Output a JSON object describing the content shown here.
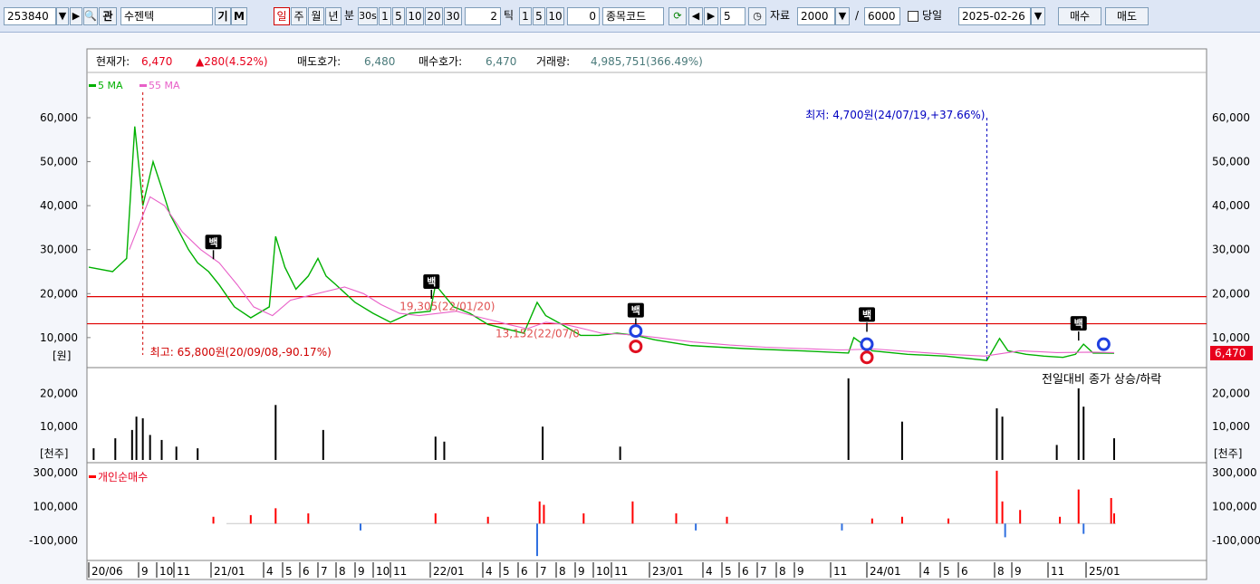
{
  "toolbar": {
    "code": "253840",
    "name": "수젠텍",
    "gi": "기",
    "m": "M",
    "periods": [
      "일",
      "주",
      "월",
      "년"
    ],
    "minute_label": "분",
    "minute_values": [
      "30s",
      "1",
      "5",
      "10",
      "20",
      "30"
    ],
    "minute_input": "2",
    "tick_label": "틱",
    "tick_values": [
      "1",
      "5",
      "10"
    ],
    "tick_input": "0",
    "code_label": "종목코드",
    "step_value": "5",
    "data_label": "자료",
    "data_count": "2000",
    "total_label": "/",
    "total_count": "6000",
    "today_label": "당일",
    "date": "2025-02-26",
    "buy_label": "매수",
    "sell_label": "매도"
  },
  "info": {
    "price_label": "현재가:",
    "price": "6,470",
    "change": "▲280(4.52%)",
    "ask_label": "매도호가:",
    "ask": "6,480",
    "bid_label": "매수호가:",
    "bid": "6,470",
    "volume_label": "거래량:",
    "volume": "4,985,751(366.49%)"
  },
  "colors": {
    "up": "#e8001c",
    "down": "#0033cc",
    "ma5": "#00b000",
    "ma55": "#e860c8",
    "candle_up": "#ff0000",
    "candle_down": "#0000ff",
    "volume": "#000000",
    "net_up": "#ff0000",
    "net_down": "#3070e0",
    "annot_high": "#d00000",
    "annot_low": "#0000c0",
    "hline": "#e00000",
    "last_badge": "#e8001c"
  },
  "chart_data": [
    {
      "type": "line",
      "panel": "price",
      "unit_label": "[원]",
      "y_range": [
        4000,
        67000
      ],
      "y_ticks": [
        10000,
        20000,
        30000,
        40000,
        50000,
        60000
      ],
      "y_tick_labels": [
        "10,000",
        "20,000",
        "30,000",
        "40,000",
        "50,000",
        "60,000"
      ],
      "legend": [
        "5 MA",
        "55 MA"
      ],
      "series": [
        {
          "name": "5 MA",
          "x": [
            "2020-06-01",
            "2020-07-15",
            "2020-08-10",
            "2020-08-25",
            "2020-09-08",
            "2020-09-25",
            "2020-10-10",
            "2020-10-25",
            "2020-11-10",
            "2020-11-25",
            "2020-12-10",
            "2020-12-28",
            "2021-01-15",
            "2021-02-10",
            "2021-03-10",
            "2021-04-10",
            "2021-04-20",
            "2021-05-05",
            "2021-05-25",
            "2021-06-15",
            "2021-07-01",
            "2021-07-15",
            "2021-08-01",
            "2021-09-01",
            "2021-10-01",
            "2021-11-01",
            "2021-12-01",
            "2022-01-01",
            "2022-01-10",
            "2022-02-10",
            "2022-03-10",
            "2022-04-10",
            "2022-05-10",
            "2022-06-10",
            "2022-07-01",
            "2022-07-15",
            "2022-08-10",
            "2022-09-10",
            "2022-10-10",
            "2022-11-10",
            "2022-12-10",
            "2023-01-10",
            "2023-03-10",
            "2023-06-10",
            "2023-09-10",
            "2023-12-01",
            "2023-12-10",
            "2024-01-10",
            "2024-03-10",
            "2024-05-10",
            "2024-07-19",
            "2024-08-10",
            "2024-08-25",
            "2024-09-25",
            "2024-10-25",
            "2024-11-25",
            "2024-12-15",
            "2024-12-28",
            "2025-01-15",
            "2025-02-26"
          ],
          "values": [
            26000,
            25000,
            28000,
            58000,
            40000,
            50000,
            44000,
            38000,
            34000,
            30000,
            27000,
            25000,
            22000,
            17000,
            14500,
            17000,
            33000,
            26000,
            21000,
            24000,
            28000,
            24000,
            22000,
            18000,
            15500,
            13500,
            15500,
            16000,
            22000,
            17000,
            15500,
            13000,
            12000,
            11000,
            18000,
            15000,
            13000,
            10500,
            10500,
            11000,
            10500,
            9500,
            8200,
            7500,
            7000,
            6500,
            10000,
            7000,
            6200,
            5800,
            4800,
            9800,
            7000,
            6200,
            5800,
            5500,
            6200,
            8500,
            6500,
            6470
          ]
        },
        {
          "name": "55 MA",
          "x": [
            "2020-08-15",
            "2020-09-20",
            "2020-10-15",
            "2020-11-15",
            "2020-12-15",
            "2021-01-15",
            "2021-02-15",
            "2021-03-15",
            "2021-04-15",
            "2021-05-15",
            "2021-06-15",
            "2021-07-15",
            "2021-08-15",
            "2021-09-15",
            "2021-10-15",
            "2021-11-15",
            "2021-12-15",
            "2022-01-15",
            "2022-02-15",
            "2022-03-15",
            "2022-04-15",
            "2022-05-15",
            "2022-06-15",
            "2022-07-15",
            "2022-08-15",
            "2022-09-15",
            "2022-10-15",
            "2022-11-15",
            "2022-12-15",
            "2023-01-15",
            "2023-03-15",
            "2023-05-15",
            "2023-07-15",
            "2023-09-15",
            "2023-11-15",
            "2024-01-15",
            "2024-03-15",
            "2024-05-15",
            "2024-07-15",
            "2024-09-15",
            "2024-11-15",
            "2025-01-15",
            "2025-02-26"
          ],
          "values": [
            30000,
            42000,
            40000,
            34000,
            30000,
            27000,
            22000,
            17000,
            15000,
            18500,
            19500,
            20500,
            21500,
            20000,
            17500,
            15500,
            15000,
            15500,
            16000,
            15000,
            14000,
            13000,
            12000,
            13500,
            13000,
            12000,
            11000,
            10800,
            10500,
            10000,
            9000,
            8300,
            7800,
            7500,
            7200,
            7400,
            6800,
            6200,
            5800,
            7000,
            6600,
            6700,
            6600
          ]
        }
      ],
      "horizontal_lines": [
        19305,
        13152
      ],
      "annotations": [
        {
          "text": "최고: 65,800원(20/09/08,-90.17%)",
          "x": "2020-09-08",
          "y": 65800,
          "kind": "high"
        },
        {
          "text": "최저: 4,700원(24/07/19,+37.66%)",
          "x": "2024-07-19",
          "y": 4700,
          "kind": "low"
        },
        {
          "text": "19,305(22/01/20)",
          "x": "2022-01-20",
          "y": 19305,
          "kind": "level"
        },
        {
          "text": "13,152(22/07/0",
          "x": "2022-07-01",
          "y": 13152,
          "kind": "level"
        }
      ],
      "signals": [
        {
          "label": "백",
          "x": "2021-01-05",
          "y": 27000
        },
        {
          "label": "백",
          "x": "2022-01-03",
          "y": 18000
        },
        {
          "label": "백",
          "x": "2022-12-10",
          "y": 11500
        },
        {
          "label": "백",
          "x": "2024-01-01",
          "y": 10500
        },
        {
          "label": "백",
          "x": "2024-12-20",
          "y": 8500
        }
      ],
      "circle_signals": [
        {
          "x": "2022-12-10",
          "y": 11500,
          "kind": "blue"
        },
        {
          "x": "2022-12-10",
          "y": 8000,
          "kind": "red"
        },
        {
          "x": "2024-01-01",
          "y": 8500,
          "kind": "blue"
        },
        {
          "x": "2024-01-01",
          "y": 5500,
          "kind": "red"
        },
        {
          "x": "2025-02-05",
          "y": 8500,
          "kind": "blue"
        }
      ],
      "last_value": 6470,
      "last_value_label": "6,470"
    },
    {
      "type": "bar",
      "panel": "volume",
      "title": "전일대비 종가 상승/하락",
      "unit_label": "[천주]",
      "y_range": [
        0,
        25000
      ],
      "y_ticks": [
        10000,
        20000
      ],
      "y_tick_labels": [
        "10,000",
        "20,000"
      ],
      "x": [
        "2020-06-10",
        "2020-07-20",
        "2020-08-20",
        "2020-08-28",
        "2020-09-08",
        "2020-09-20",
        "2020-10-10",
        "2020-11-05",
        "2020-12-10",
        "2021-04-20",
        "2021-07-10",
        "2022-01-10",
        "2022-01-25",
        "2022-07-10",
        "2022-11-15",
        "2023-12-01",
        "2024-03-01",
        "2024-08-05",
        "2024-08-15",
        "2024-11-15",
        "2024-12-20",
        "2024-12-28",
        "2025-02-26"
      ],
      "values": [
        3500,
        6500,
        9000,
        13000,
        12500,
        7500,
        6000,
        4000,
        3500,
        16500,
        9000,
        7000,
        5500,
        10000,
        4000,
        24500,
        11500,
        15500,
        13000,
        4500,
        21500,
        16000,
        6500
      ]
    },
    {
      "type": "bar",
      "panel": "net_buy",
      "legend": [
        "개인순매수"
      ],
      "y_range": [
        -200000,
        320000
      ],
      "y_ticks": [
        -100000,
        100000,
        300000
      ],
      "y_tick_labels": [
        "-100,000",
        "100,000",
        "300,000"
      ],
      "x": [
        "2021-01-05",
        "2021-03-10",
        "2021-04-20",
        "2021-06-15",
        "2021-09-10",
        "2022-01-10",
        "2022-04-10",
        "2022-07-01",
        "2022-07-05",
        "2022-07-12",
        "2022-09-15",
        "2022-12-05",
        "2023-02-15",
        "2023-03-20",
        "2023-05-10",
        "2023-11-20",
        "2024-01-10",
        "2024-03-01",
        "2024-05-15",
        "2024-08-05",
        "2024-08-15",
        "2024-08-20",
        "2024-09-15",
        "2024-11-20",
        "2024-12-20",
        "2024-12-28",
        "2025-02-20",
        "2025-02-26"
      ],
      "values": [
        40000,
        50000,
        90000,
        60000,
        -40000,
        60000,
        40000,
        -190000,
        130000,
        110000,
        60000,
        130000,
        60000,
        -40000,
        40000,
        -40000,
        30000,
        40000,
        30000,
        310000,
        130000,
        -80000,
        80000,
        40000,
        200000,
        -60000,
        150000,
        60000
      ]
    }
  ],
  "x_axis": {
    "labels": [
      {
        "text": "20/06",
        "x": "2020-06-01"
      },
      {
        "text": "9",
        "x": "2020-09-01"
      },
      {
        "text": "10",
        "x": "2020-10-01"
      },
      {
        "text": "11",
        "x": "2020-11-01"
      },
      {
        "text": "21/01",
        "x": "2021-01-01"
      },
      {
        "text": "4",
        "x": "2021-04-01"
      },
      {
        "text": "5",
        "x": "2021-05-01"
      },
      {
        "text": "6",
        "x": "2021-06-01"
      },
      {
        "text": "7",
        "x": "2021-07-01"
      },
      {
        "text": "8",
        "x": "2021-08-01"
      },
      {
        "text": "9",
        "x": "2021-09-01"
      },
      {
        "text": "10",
        "x": "2021-10-01"
      },
      {
        "text": "11",
        "x": "2021-11-01"
      },
      {
        "text": "22/01",
        "x": "2022-01-01"
      },
      {
        "text": "4",
        "x": "2022-04-01"
      },
      {
        "text": "5",
        "x": "2022-05-01"
      },
      {
        "text": "6",
        "x": "2022-06-01"
      },
      {
        "text": "7",
        "x": "2022-07-01"
      },
      {
        "text": "8",
        "x": "2022-08-01"
      },
      {
        "text": "9",
        "x": "2022-09-01"
      },
      {
        "text": "10",
        "x": "2022-10-01"
      },
      {
        "text": "11",
        "x": "2022-11-01"
      },
      {
        "text": "23/01",
        "x": "2023-01-01"
      },
      {
        "text": "4",
        "x": "2023-04-01"
      },
      {
        "text": "5",
        "x": "2023-05-01"
      },
      {
        "text": "6",
        "x": "2023-06-01"
      },
      {
        "text": "7",
        "x": "2023-07-01"
      },
      {
        "text": "8",
        "x": "2023-08-01"
      },
      {
        "text": "9",
        "x": "2023-09-01"
      },
      {
        "text": "11",
        "x": "2023-11-01"
      },
      {
        "text": "24/01",
        "x": "2024-01-01"
      },
      {
        "text": "4",
        "x": "2024-04-01"
      },
      {
        "text": "5",
        "x": "2024-05-01"
      },
      {
        "text": "6",
        "x": "2024-06-01"
      },
      {
        "text": "8",
        "x": "2024-08-01"
      },
      {
        "text": "9",
        "x": "2024-09-01"
      },
      {
        "text": "11",
        "x": "2024-11-01"
      },
      {
        "text": "25/01",
        "x": "2025-01-01"
      }
    ],
    "anchors": [
      {
        "x": "2020-06-01"
      },
      {
        "x": "2020-09-01"
      },
      {
        "x": "2020-10-01"
      },
      {
        "x": "2020-11-01"
      },
      {
        "x": "2021-01-01"
      },
      {
        "x": "2021-04-01"
      },
      {
        "x": "2021-05-01"
      },
      {
        "x": "2021-06-01"
      },
      {
        "x": "2021-07-01"
      },
      {
        "x": "2021-08-01"
      },
      {
        "x": "2021-09-01"
      },
      {
        "x": "2021-10-01"
      },
      {
        "x": "2021-11-01"
      },
      {
        "x": "2022-01-01"
      },
      {
        "x": "2022-04-01"
      },
      {
        "x": "2022-05-01"
      },
      {
        "x": "2022-06-01"
      },
      {
        "x": "2022-07-01"
      },
      {
        "x": "2022-08-01"
      },
      {
        "x": "2022-09-01"
      },
      {
        "x": "2022-10-01"
      },
      {
        "x": "2022-11-01"
      },
      {
        "x": "2023-01-01"
      },
      {
        "x": "2023-04-01"
      },
      {
        "x": "2023-05-01"
      },
      {
        "x": "2023-06-01"
      },
      {
        "x": "2023-07-01"
      },
      {
        "x": "2023-08-01"
      },
      {
        "x": "2023-09-01"
      },
      {
        "x": "2023-11-01"
      },
      {
        "x": "2024-01-01"
      },
      {
        "x": "2024-04-01"
      },
      {
        "x": "2024-05-01"
      },
      {
        "x": "2024-06-01"
      },
      {
        "x": "2024-08-01"
      },
      {
        "x": "2024-09-01"
      },
      {
        "x": "2024-11-01"
      },
      {
        "x": "2025-01-01"
      },
      {
        "x": "2025-02-26"
      }
    ]
  }
}
